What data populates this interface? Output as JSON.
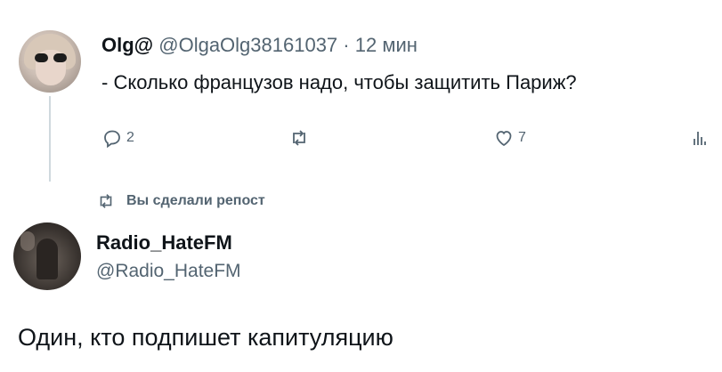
{
  "original_post": {
    "author_name": "Olg@",
    "handle": "@OlgaOlg38161037",
    "separator": "·",
    "time": "12 мин",
    "text": "- Сколько французов надо, чтобы защитить Париж?",
    "actions": {
      "reply": {
        "icon": "reply-icon",
        "count": "2"
      },
      "repost": {
        "icon": "repost-icon",
        "count": ""
      },
      "like": {
        "icon": "heart-icon",
        "count": "7"
      },
      "views": {
        "icon": "views-icon",
        "count": ""
      }
    }
  },
  "repost_note": {
    "icon": "repost-icon",
    "text": "Вы сделали репост"
  },
  "reposter": {
    "name": "Radio_HateFM",
    "handle": "@Radio_HateFM",
    "text": "Один, кто подпишет капитуляцию"
  },
  "colors": {
    "text_primary": "#0f1419",
    "text_secondary": "#536471",
    "thread_line": "#cfd9de",
    "background": "#ffffff"
  }
}
